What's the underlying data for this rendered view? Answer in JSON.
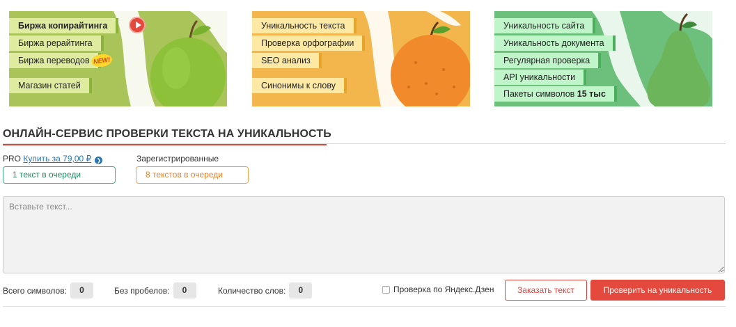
{
  "banners": [
    {
      "fruit": "apple-icon",
      "items": [
        "Биржа копирайтинга",
        "Биржа рерайтинга",
        "Биржа переводов",
        "Магазин статей"
      ],
      "new_badge": "NEW!"
    },
    {
      "fruit": "orange-icon",
      "items": [
        "Уникальность текста",
        "Проверка орфографии",
        "SEO анализ",
        "Синонимы к слову"
      ]
    },
    {
      "fruit": "pear-icon",
      "items": [
        "Уникальность сайта",
        "Уникальность документа",
        "Регулярная проверка",
        "API уникальности"
      ],
      "packets_prefix": "Пакеты символов",
      "packets_bold": "15 тыс"
    }
  ],
  "page_title": "ОНЛАЙН-СЕРВИС ПРОВЕРКИ ТЕКСТА НА УНИКАЛЬНОСТЬ",
  "pro": {
    "label": "PRO",
    "buy_link": "Купить за 79,00 ₽",
    "queue": "1 текст в очереди"
  },
  "registered": {
    "label": "Зарегистрированные",
    "queue": "8 текстов в очереди"
  },
  "text_input": {
    "placeholder": "Вставьте текст...",
    "value": ""
  },
  "stats": {
    "total_label": "Всего символов:",
    "total_value": "0",
    "nospace_label": "Без пробелов:",
    "nospace_value": "0",
    "words_label": "Количество слов:",
    "words_value": "0"
  },
  "dzen_checkbox": {
    "label": "Проверка по Яндекс.Дзен",
    "checked": false
  },
  "buttons": {
    "order": "Заказать текст",
    "check": "Проверить на уникальность"
  },
  "colors": {
    "accent_red": "#e5483c",
    "banner_green": "#a9c458",
    "banner_orange": "#f2b64c",
    "banner_mint": "#6cc07b",
    "link_blue": "#2a74b5"
  }
}
